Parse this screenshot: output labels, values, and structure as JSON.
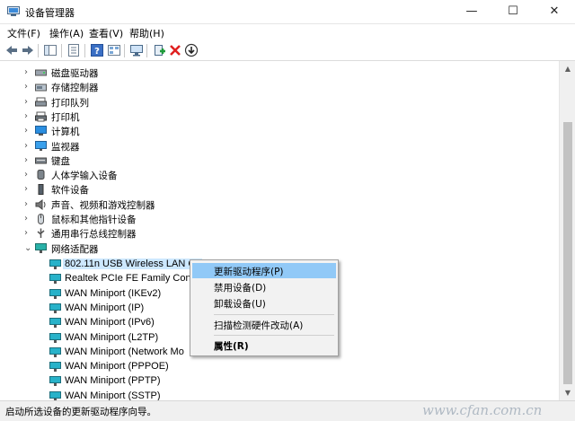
{
  "window": {
    "title": "设备管理器",
    "min": "—",
    "max": "☐",
    "close": "✕"
  },
  "menu": [
    "文件(F)",
    "操作(A)",
    "查看(V)",
    "帮助(H)"
  ],
  "categories": [
    {
      "label": "磁盘驱动器",
      "icon": "disk-drive-icon"
    },
    {
      "label": "存储控制器",
      "icon": "storage-controller-icon"
    },
    {
      "label": "打印队列",
      "icon": "print-queue-icon"
    },
    {
      "label": "打印机",
      "icon": "printer-icon"
    },
    {
      "label": "计算机",
      "icon": "computer-icon"
    },
    {
      "label": "监视器",
      "icon": "monitor-icon"
    },
    {
      "label": "键盘",
      "icon": "keyboard-icon"
    },
    {
      "label": "人体学输入设备",
      "icon": "hid-icon"
    },
    {
      "label": "软件设备",
      "icon": "software-device-icon"
    },
    {
      "label": "声音、视频和游戏控制器",
      "icon": "sound-icon"
    },
    {
      "label": "鼠标和其他指针设备",
      "icon": "mouse-icon"
    },
    {
      "label": "通用串行总线控制器",
      "icon": "usb-icon"
    },
    {
      "label": "网络适配器",
      "icon": "network-adapter-icon"
    }
  ],
  "adapters": [
    "802.11n USB Wireless LAN Ca",
    "Realtek PCIe FE Family Contro",
    "WAN Miniport (IKEv2)",
    "WAN Miniport (IP)",
    "WAN Miniport (IPv6)",
    "WAN Miniport (L2TP)",
    "WAN Miniport (Network Mo",
    "WAN Miniport (PPPOE)",
    "WAN Miniport (PPTP)",
    "WAN Miniport (SSTP)"
  ],
  "context_menu": {
    "update_driver": "更新驱动程序(P)",
    "disable": "禁用设备(D)",
    "uninstall": "卸载设备(U)",
    "scan": "扫描检测硬件改动(A)",
    "properties": "属性(R)"
  },
  "status": "启动所选设备的更新驱动程序向导。",
  "watermark": "www.cfan.com.cn",
  "colors": {
    "selection": "#cde8ff",
    "menu_hover": "#91c9f7",
    "accent": "#0078d7"
  }
}
